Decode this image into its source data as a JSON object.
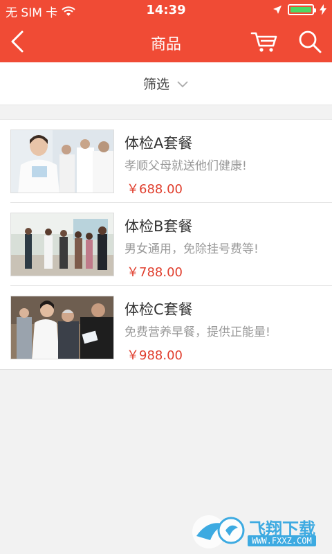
{
  "status": {
    "carrier": "无 SIM 卡",
    "time": "14:39"
  },
  "nav": {
    "title": "商品"
  },
  "filter": {
    "label": "筛选"
  },
  "products": [
    {
      "title": "体检A套餐",
      "desc": "孝顺父母就送他们健康!",
      "price": "￥688.00"
    },
    {
      "title": "体检B套餐",
      "desc": "男女通用，免除挂号费等!",
      "price": "￥788.00"
    },
    {
      "title": "体检C套餐",
      "desc": "免费营养早餐，提供正能量!",
      "price": "￥988.00"
    }
  ],
  "watermark": {
    "brand": "飞翔下载",
    "url": "WWW.FXXZ.COM"
  },
  "colors": {
    "header_bg": "#f04b35",
    "price": "#e03e2d",
    "battery": "#4cd964"
  }
}
